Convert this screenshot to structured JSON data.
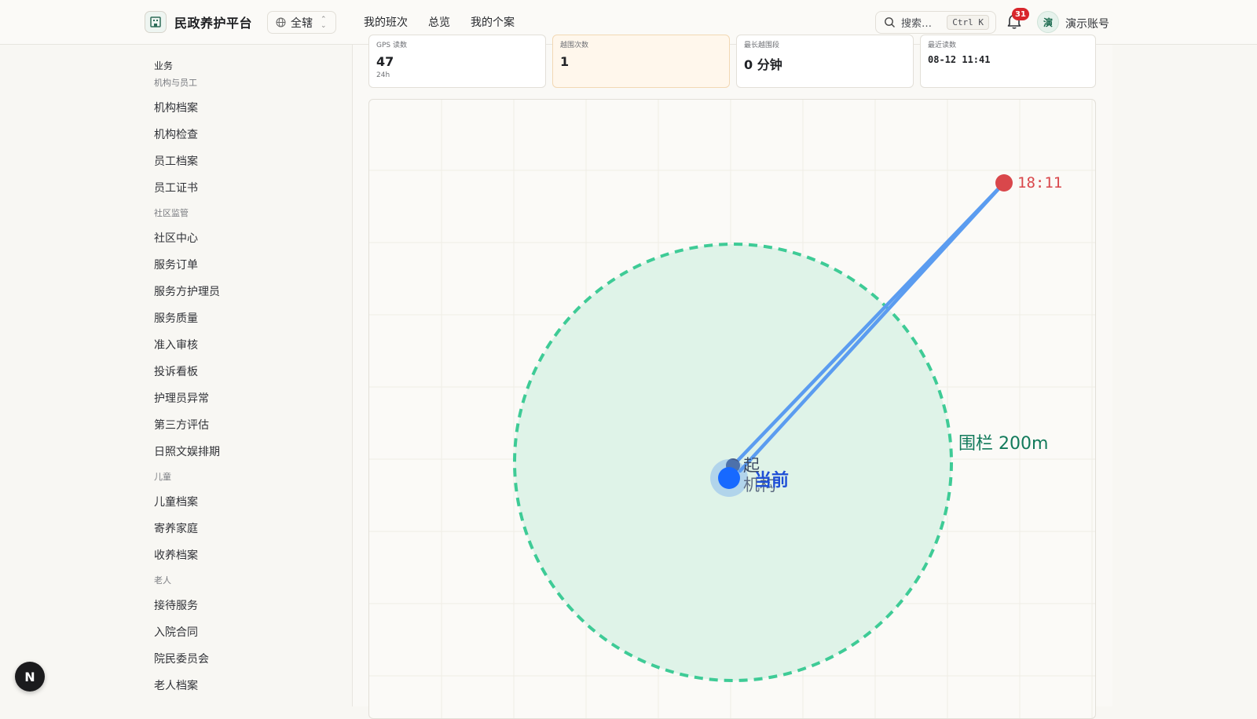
{
  "header": {
    "brand_name": "民政养护平台",
    "scope_label": "全辖",
    "nav": [
      "我的班次",
      "总览",
      "我的个案"
    ],
    "search_label": "搜索…",
    "search_shortcut": "Ctrl K",
    "notification_count": "31",
    "avatar_text": "演",
    "account_name": "演示账号"
  },
  "sidebar": {
    "sections": [
      {
        "title": "业务",
        "kind": "group"
      },
      {
        "title": "机构与员工",
        "kind": "sub"
      },
      {
        "title": "机构档案",
        "kind": "item"
      },
      {
        "title": "机构检查",
        "kind": "item"
      },
      {
        "title": "员工档案",
        "kind": "item"
      },
      {
        "title": "员工证书",
        "kind": "item"
      },
      {
        "title": "社区监管",
        "kind": "sub"
      },
      {
        "title": "社区中心",
        "kind": "item"
      },
      {
        "title": "服务订单",
        "kind": "item"
      },
      {
        "title": "服务方护理员",
        "kind": "item"
      },
      {
        "title": "服务质量",
        "kind": "item"
      },
      {
        "title": "准入审核",
        "kind": "item"
      },
      {
        "title": "投诉看板",
        "kind": "item"
      },
      {
        "title": "护理员异常",
        "kind": "item"
      },
      {
        "title": "第三方评估",
        "kind": "item"
      },
      {
        "title": "日照文娱排期",
        "kind": "item"
      },
      {
        "title": "儿童",
        "kind": "sub"
      },
      {
        "title": "儿童档案",
        "kind": "item"
      },
      {
        "title": "寄养家庭",
        "kind": "item"
      },
      {
        "title": "收养档案",
        "kind": "item"
      },
      {
        "title": "老人",
        "kind": "sub"
      },
      {
        "title": "接待服务",
        "kind": "item"
      },
      {
        "title": "入院合同",
        "kind": "item"
      },
      {
        "title": "院民委员会",
        "kind": "item"
      },
      {
        "title": "老人档案",
        "kind": "item"
      }
    ],
    "fab_label": "N"
  },
  "stats": [
    {
      "label": "GPS 读数",
      "value": "47",
      "sub": "24h",
      "warn": false
    },
    {
      "label": "越围次数",
      "value": "1",
      "sub": "",
      "warn": true
    },
    {
      "label": "最长越围段",
      "value": "0 分钟",
      "sub": "",
      "warn": false
    },
    {
      "label": "最近读数",
      "value": "08-12 11:41",
      "sub": "",
      "warn": false
    }
  ],
  "map": {
    "fence_label": "围栏 200m",
    "start_label": "起",
    "agency_label": "机构",
    "current_label": "当前",
    "far_point_label": "18:11",
    "colors": {
      "fence": "#3ecb96",
      "fence_fill": "#dff3e8",
      "track": "#5b9cf0",
      "current": "#1769ff",
      "far_point": "#d9474b",
      "fence_text": "#127a5b",
      "current_text": "#1f4fd6"
    }
  }
}
